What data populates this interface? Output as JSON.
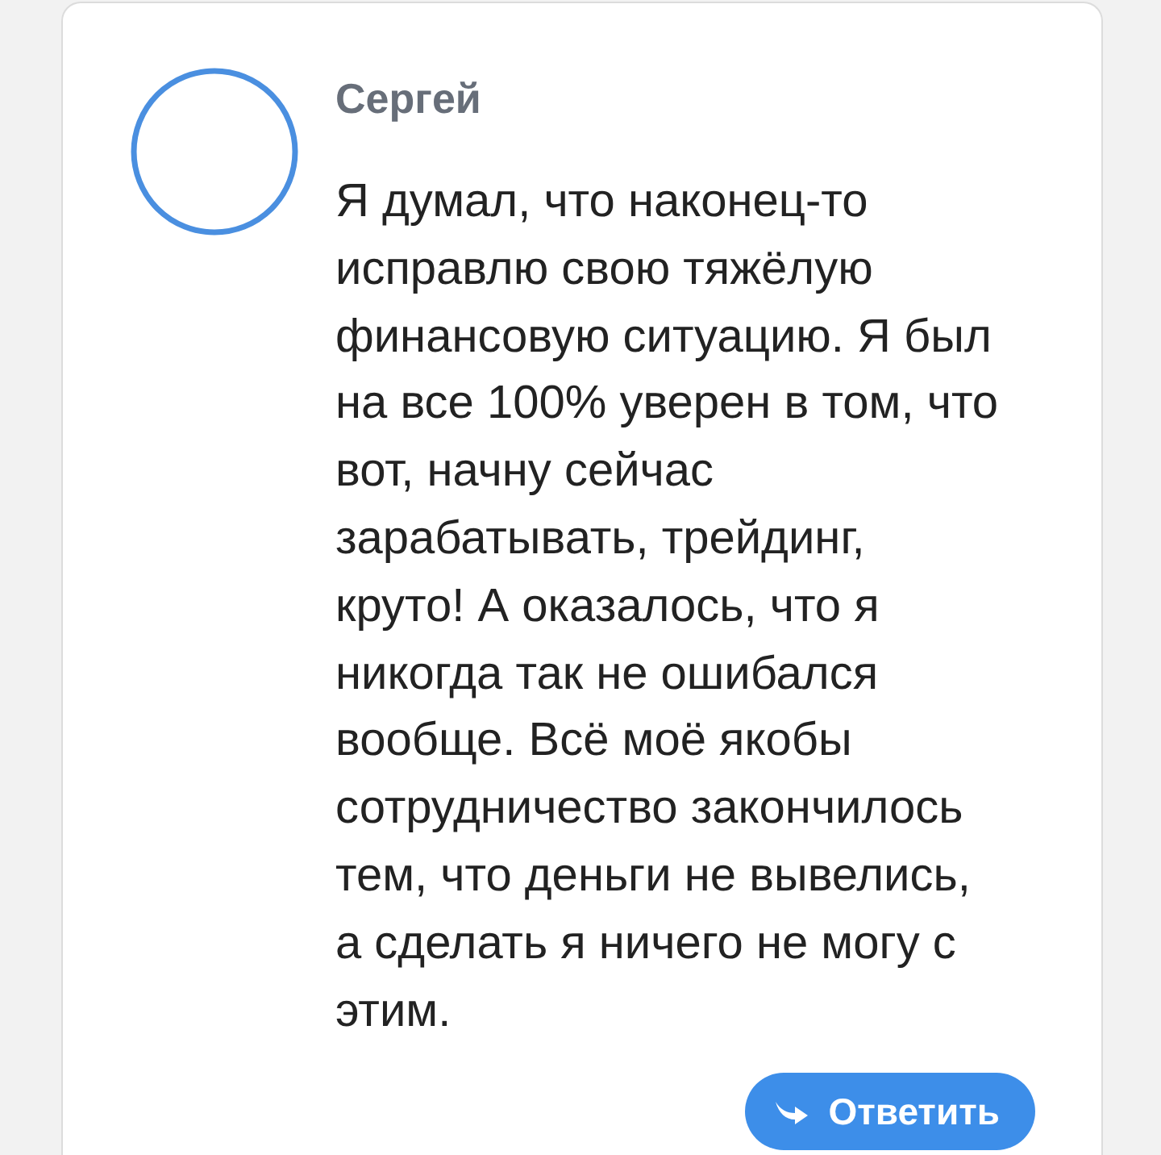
{
  "comment": {
    "author": "Сергей",
    "text": "Я думал, что наконец-то исправлю свою тяжёлую финансовую ситуацию. Я был на все 100% уверен в том, что вот, начну сейчас\nзарабатывать, трейдинг,\nкруто! А оказалось, что я никогда так не ошибался вообще. Всё моё якобы сотрудничество закончилось тем, что деньги не вывелись, а сделать я ничего не могу с этим.",
    "reply_button": "Ответить"
  }
}
